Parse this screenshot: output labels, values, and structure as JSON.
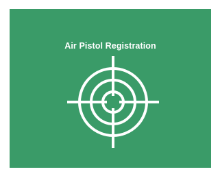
{
  "tile": {
    "title": "Air Pistol Registration",
    "icon": "crosshair-target-icon",
    "background_color": "#3a9b68",
    "text_color": "#ffffff"
  }
}
